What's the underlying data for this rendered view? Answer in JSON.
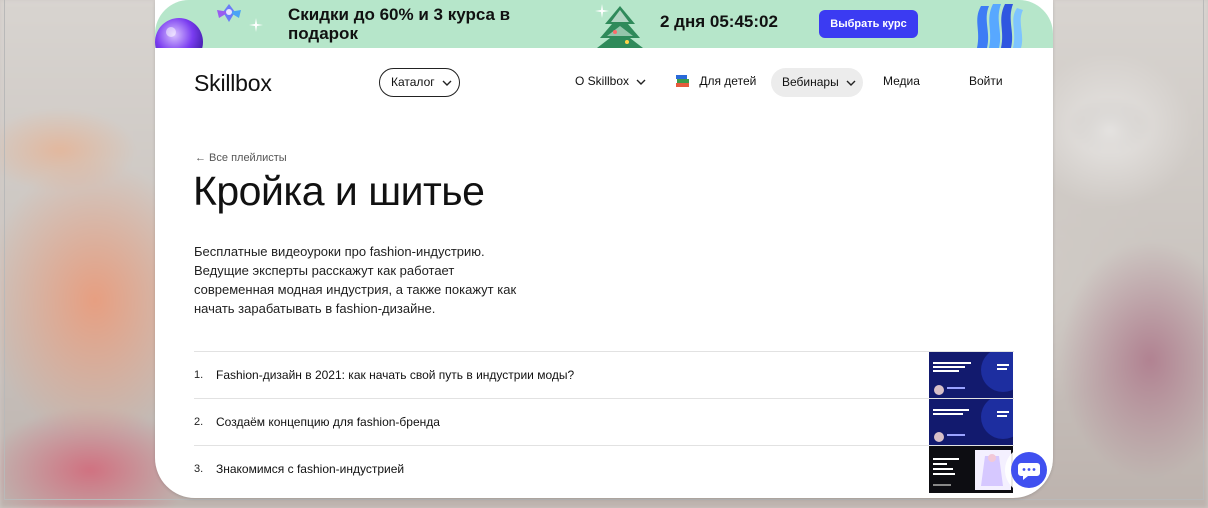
{
  "promo": {
    "text": "Скидки до 60% и 3 курса в подарок",
    "timer": "2 дня 05:45:02",
    "button_label": "Выбрать курс"
  },
  "header": {
    "logo": "Skillbox",
    "catalog_label": "Каталог",
    "nav": {
      "about": "О Skillbox",
      "kids": "Для детей",
      "webinars": "Вебинары",
      "media": "Медиа",
      "login": "Войти"
    }
  },
  "page": {
    "back_link": "← Все плейлисты",
    "title": "Кройка и шитье",
    "description": "Бесплатные видеоуроки про fashion-индустрию. Ведущие эксперты расскажут как работает современная модная индустрия, а также покажут как начать зарабатывать в fashion-дизайне."
  },
  "playlist": [
    {
      "num": "1.",
      "title": "Fashion-дизайн в 2021: как начать свой путь в индустрии моды?"
    },
    {
      "num": "2.",
      "title": "Создаём концепцию для fashion-бренда"
    },
    {
      "num": "3.",
      "title": "Знакомимся с fashion-индустрией"
    }
  ],
  "colors": {
    "promo_bg": "#b6e6ca",
    "accent": "#3b3bf2",
    "thumb_bg": "#121a6e"
  },
  "icons": {
    "catalog_chevron": "chevron-down-icon",
    "kids": "books-icon",
    "back": "arrow-left-icon",
    "chat": "chat-bubble-icon"
  }
}
